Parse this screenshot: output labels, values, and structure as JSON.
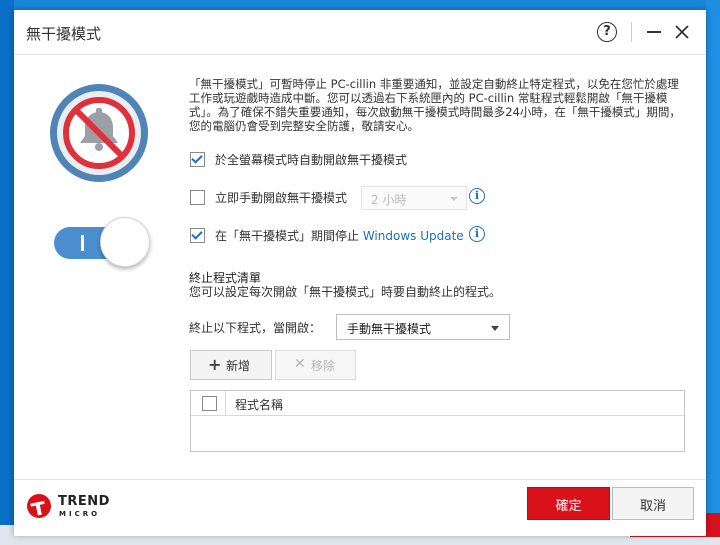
{
  "window": {
    "title": "無干擾模式",
    "help_label": "?"
  },
  "intro": {
    "description": "「無干擾模式」可暫時停止 PC-cillin 非重要通知，並設定自動終止特定程式，以免在您忙於處理工作或玩遊戲時造成中斷。您可以透過右下系統匣內的 PC-cillin 常駐程式輕鬆開啟「無干擾模式」。為了確保不錯失重要通知，每次啟動無干擾模式時間最多24小時，在「無干擾模式」期間，您的電腦仍會受到完整安全防護，敬請安心。"
  },
  "options": {
    "auto_fullscreen": {
      "label": "於全螢幕模式時自動開啟無干擾模式",
      "checked": true
    },
    "manual_enable": {
      "label": "立即手動開啟無干擾模式",
      "checked": false,
      "duration": "2 小時"
    },
    "stop_windows_update": {
      "label_prefix": "在「無干擾模式」期間停止 ",
      "label_link": "Windows Update",
      "checked": true
    }
  },
  "info_icon_glyph": "i",
  "termination": {
    "title": "終止程式清單",
    "description": "您可以設定每次開啟「無干擾模式」時要自動終止的程式。",
    "when_label": "終止以下程式，當開啟：",
    "when_value": "手動無干擾模式",
    "add_label": "新增",
    "remove_label": "移除",
    "table_header": "程式名稱",
    "rows": []
  },
  "footer": {
    "brand_top": "TREND",
    "brand_bottom": "MICRO",
    "ok_label": "確定",
    "cancel_label": "取消"
  },
  "colors": {
    "accent": "#1f6fc0",
    "primary_button": "#d8111b",
    "toggle_on": "#4a8ed0"
  },
  "icons": {
    "hero": "muted-bell-icon",
    "add": "plus-icon",
    "remove": "x-icon",
    "info": "info-icon"
  }
}
